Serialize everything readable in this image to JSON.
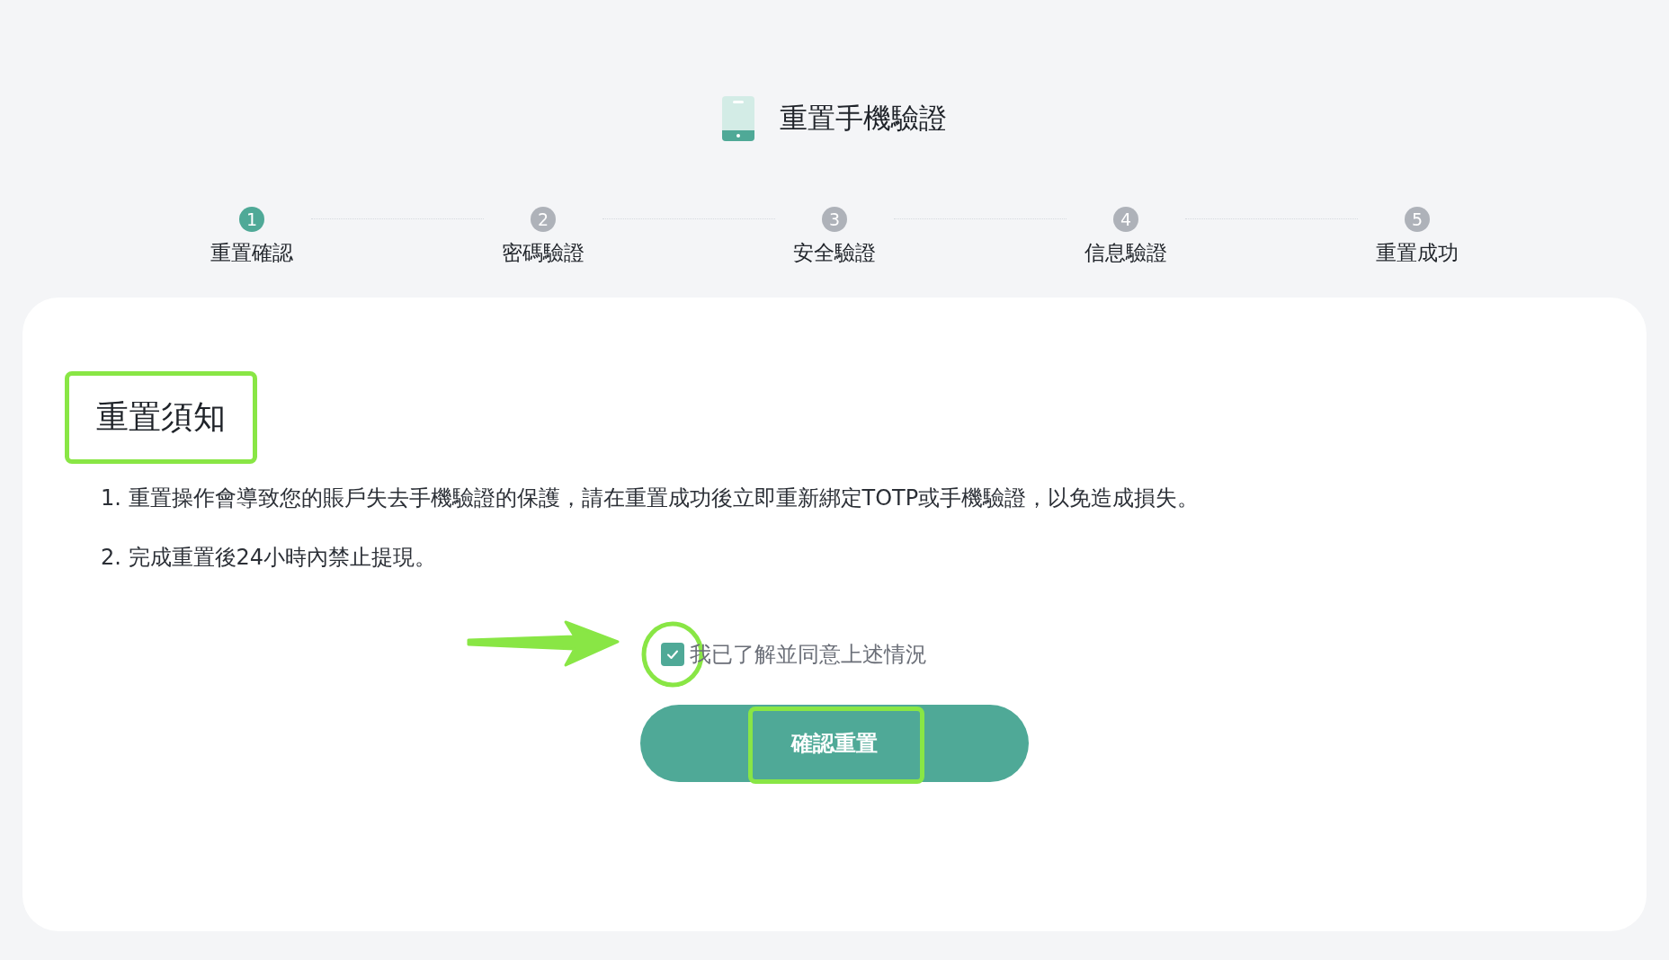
{
  "page_title": "重置手機驗證",
  "steps": [
    {
      "number": "1",
      "label": "重置確認",
      "selected": true
    },
    {
      "number": "2",
      "label": "密碼驗證",
      "selected": false
    },
    {
      "number": "3",
      "label": "安全驗證",
      "selected": false
    },
    {
      "number": "4",
      "label": "信息驗證",
      "selected": false
    },
    {
      "number": "5",
      "label": "重置成功",
      "selected": false
    }
  ],
  "notice": {
    "heading": "重置須知",
    "items": [
      "1. 重置操作會導致您的賬戶失去手機驗證的保護，請在重置成功後立即重新綁定TOTP或手機驗證，以免造成損失。",
      "2. 完成重置後24小時內禁止提現。"
    ]
  },
  "agreement": {
    "label": "我已了解並同意上述情況",
    "checked": true
  },
  "confirm_button": "確認重置"
}
